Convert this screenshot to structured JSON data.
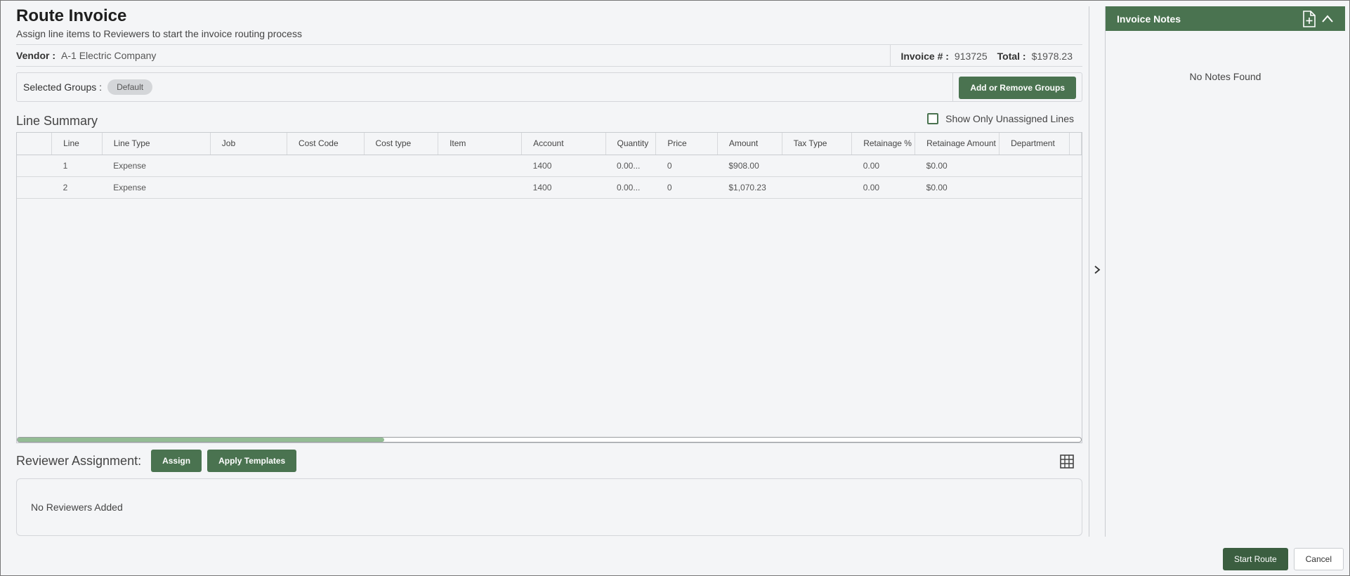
{
  "header": {
    "title": "Route Invoice",
    "subtitle": "Assign line items to Reviewers to start the invoice routing process"
  },
  "vendor": {
    "label": "Vendor :",
    "value": "A-1 Electric Company",
    "invoice_label": "Invoice # :",
    "invoice_value": "913725",
    "total_label": "Total :",
    "total_value": "$1978.23"
  },
  "groups": {
    "label": "Selected Groups :",
    "chip": "Default",
    "button": "Add or Remove Groups"
  },
  "line_summary": {
    "title": "Line Summary",
    "show_unassigned_label": "Show Only Unassigned Lines",
    "show_unassigned_checked": false,
    "columns": [
      "",
      "Line",
      "Line Type",
      "Job",
      "Cost Code",
      "Cost type",
      "Item",
      "Account",
      "Quantity",
      "Price",
      "Amount",
      "Tax Type",
      "Retainage %",
      "Retainage Amount",
      "Department"
    ],
    "rows": [
      [
        "",
        "1",
        "Expense",
        "",
        "",
        "",
        "",
        "1400",
        "0.00...",
        "0",
        "$908.00",
        "",
        "0.00",
        "$0.00",
        ""
      ],
      [
        "",
        "2",
        "Expense",
        "",
        "",
        "",
        "",
        "1400",
        "0.00...",
        "0",
        "$1,070.23",
        "",
        "0.00",
        "$0.00",
        ""
      ]
    ]
  },
  "reviewer": {
    "title": "Reviewer Assignment:",
    "assign_button": "Assign",
    "templates_button": "Apply Templates",
    "empty_text": "No Reviewers Added"
  },
  "notes": {
    "title": "Invoice Notes",
    "empty_text": "No Notes Found"
  },
  "footer": {
    "start_button": "Start Route",
    "cancel_button": "Cancel"
  },
  "colors": {
    "accent": "#4a7350",
    "accent_dark": "#3b5e40",
    "background": "#f4f5f7"
  },
  "icons": [
    "add-note-icon",
    "chevron-up-icon",
    "chevron-right-icon",
    "grid-icon"
  ]
}
